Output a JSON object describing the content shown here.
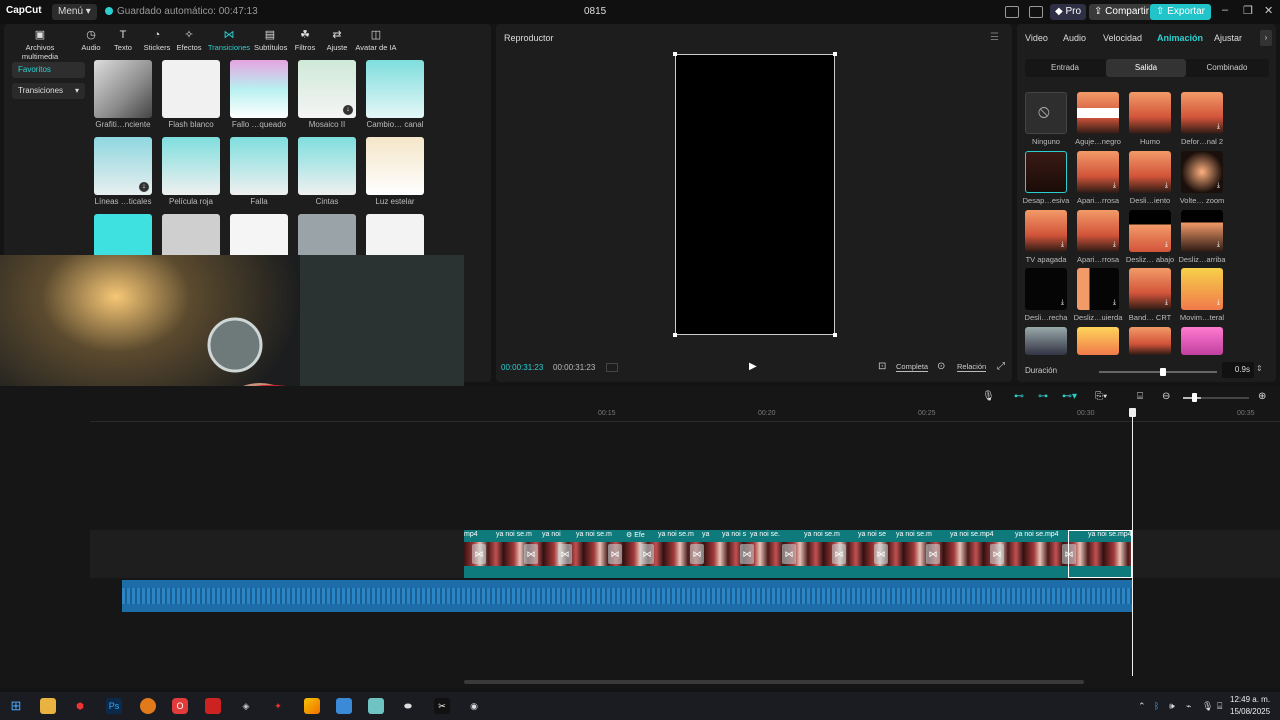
{
  "titlebar": {
    "logo": "CapCut",
    "menu": "Menú",
    "autosave": "Guardado automático: 00:47:13",
    "project_title": "0815",
    "pro": "Pro",
    "share": "Compartir",
    "export": "Exportar"
  },
  "toolbar": {
    "items": [
      {
        "label": "Archivos multimedia",
        "icon": "media-icon"
      },
      {
        "label": "Audio",
        "icon": "audio-icon"
      },
      {
        "label": "Texto",
        "icon": "text-icon"
      },
      {
        "label": "Stickers",
        "icon": "sticker-icon"
      },
      {
        "label": "Efectos",
        "icon": "effects-icon"
      },
      {
        "label": "Transiciones",
        "icon": "transitions-icon"
      },
      {
        "label": "Subtítulos",
        "icon": "subtitles-icon"
      },
      {
        "label": "Filtros",
        "icon": "filters-icon"
      },
      {
        "label": "Ajuste",
        "icon": "adjust-icon"
      },
      {
        "label": "Avatar de IA",
        "icon": "ai-avatar-icon"
      }
    ]
  },
  "sidebar": {
    "favorites": "Favoritos",
    "transitions": "Transiciones"
  },
  "transitions": [
    {
      "label": "Grafiti…nciente"
    },
    {
      "label": "Flash blanco"
    },
    {
      "label": "Fallo …queado"
    },
    {
      "label": "Mosaico II"
    },
    {
      "label": "Cambio… canal"
    },
    {
      "label": "Líneas …ticales"
    },
    {
      "label": "Película roja"
    },
    {
      "label": "Falla"
    },
    {
      "label": "Cintas"
    },
    {
      "label": "Luz estelar"
    }
  ],
  "player": {
    "title": "Reproductor",
    "current_time": "00:00:31:23",
    "total_time": "00:00:31:23",
    "full": "Completa",
    "ratio": "Relación"
  },
  "right_panel": {
    "tabs": [
      "Video",
      "Audio",
      "Velocidad",
      "Animación",
      "Ajustar"
    ],
    "subtabs": [
      "Entrada",
      "Salida",
      "Combinado"
    ],
    "animations": [
      "Ninguno",
      "Aguje…negro",
      "Humo",
      "Defor…nal 2",
      "Desap…esiva",
      "Apari…rrosa",
      "Desli…iento",
      "Volte… zoom",
      "TV apagada",
      "Apari…rrosa",
      "Desliz… abajo",
      "Desliz…arriba",
      "Desli…recha",
      "Desliz…uierda",
      "Band… CRT",
      "Movim…teral"
    ],
    "duration_label": "Duración",
    "duration_value": "0.9s"
  },
  "timeline": {
    "ruler": [
      "00:15",
      "00:20",
      "00:25",
      "00:30",
      "00:35"
    ],
    "clips": [
      "mp4",
      "ya noi se.m",
      "ya noi",
      "ya noi se.m",
      "Efe",
      "ya noi se.m",
      "ya",
      "ya noi s",
      "ya noi se.",
      "ya noi se.m",
      "ya noi se",
      "ya noi se.m",
      "ya noi se.mp4",
      "ya noi se.mp4",
      "ya noi se.mp4"
    ]
  },
  "taskbar": {
    "time": "12:49 a. m.",
    "date": "15/08/2025"
  }
}
